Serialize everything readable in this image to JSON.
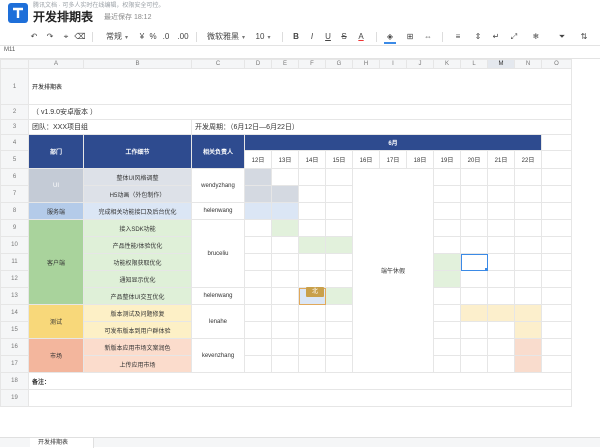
{
  "app": {
    "notice": "腾讯文档 · 可多人实时在线编辑，权限安全可控。",
    "title": "开发排期表",
    "save_status": "最近保存 18:12"
  },
  "toolbar": {
    "format_label": "常规",
    "percent": "%",
    "decimal_dec": ".0",
    "decimal_inc": ".00",
    "font_label": "微软雅黑",
    "size_label": "10",
    "bold": "B",
    "italic": "I",
    "underline": "U",
    "strike": "S",
    "font_color": "A"
  },
  "formula": {
    "name_box": "M11"
  },
  "columns": [
    "A",
    "B",
    "C",
    "D",
    "E",
    "F",
    "G",
    "H",
    "I",
    "J",
    "K",
    "L",
    "M",
    "N",
    "O"
  ],
  "active_column": "M",
  "active_row": "11",
  "sheet": {
    "title": "开发排期表",
    "version": "（ v1.9.0安卓版本 ）",
    "team": "团队：XXX项目组",
    "period": "开发周期：（6月12日—6月22日）",
    "headers": {
      "dept": "部门",
      "task": "工作细节",
      "owner": "相关负责人",
      "month": "6月"
    },
    "days": [
      "12日",
      "13日",
      "14日",
      "15日",
      "16日",
      "17日",
      "18日",
      "19日",
      "20日",
      "21日",
      "22日"
    ],
    "depts": {
      "ui": "UI",
      "server": "服务端",
      "client": "客户端",
      "test": "测试",
      "market": "市场"
    },
    "tasks": [
      "整体UI风格调整",
      "H5动画（外包制作）",
      "完成相关功能接口及后台优化",
      "接入SDK功能",
      "产品性能/体验优化",
      "功能权限获取优化",
      "通知显示优化",
      "产品整体UI交互优化",
      "版本测试及问题修复",
      "可发布版本到用户群体验",
      "新版本应用市场文案润色",
      "上传应用市场"
    ],
    "owners": {
      "ui": "wendyzhang",
      "server": "helenwang",
      "client1": "bruceliu",
      "client2": "helenwang",
      "test": "lenahe",
      "market": "kevenzhang"
    },
    "holiday": "端午休假",
    "note": "备注：",
    "comment_author": "北"
  },
  "tab": {
    "name": "开发排期表"
  },
  "colors": {
    "header_blue": "#2e4b8f",
    "ui": "#c4cbd6",
    "server": "#b4cbe9",
    "client": "#a9d39c",
    "test": "#f8d87a",
    "market": "#f3b69d",
    "selection": "#3b8ae6"
  }
}
